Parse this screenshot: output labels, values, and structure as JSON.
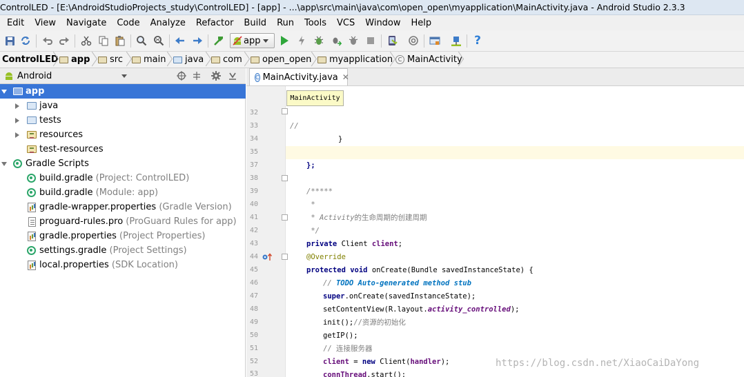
{
  "window": {
    "title": "ControlLED - [E:\\AndroidStudioProjects_study\\ControlLED] - [app] - ...\\app\\src\\main\\java\\com\\open_open\\myapplication\\MainActivity.java - Android Studio 2.3.3"
  },
  "menu": [
    "Edit",
    "View",
    "Navigate",
    "Code",
    "Analyze",
    "Refactor",
    "Build",
    "Run",
    "Tools",
    "VCS",
    "Window",
    "Help"
  ],
  "toolbar": {
    "run_config": "app",
    "icons": [
      "save-all-icon",
      "sync-icon",
      "undo-icon",
      "redo-icon",
      "cut-icon",
      "copy-icon",
      "paste-icon",
      "find-icon",
      "replace-icon",
      "back-icon",
      "forward-icon",
      "make-project-icon",
      "run-icon",
      "apply-changes-icon",
      "debug-icon",
      "attach-debugger-icon",
      "stop-icon",
      "avd-manager-icon",
      "sdk-manager-icon",
      "android-monitor-icon",
      "project-structure-icon",
      "help-icon"
    ]
  },
  "breadcrumbs": [
    "ControlLED",
    "app",
    "src",
    "main",
    "java",
    "com",
    "open_open",
    "myapplication",
    "MainActivity"
  ],
  "project_panel": {
    "view_selector": "Android",
    "tree": [
      {
        "label": "app",
        "hint": ""
      },
      {
        "label": "java",
        "hint": ""
      },
      {
        "label": "tests",
        "hint": ""
      },
      {
        "label": "resources",
        "hint": ""
      },
      {
        "label": "test-resources",
        "hint": ""
      },
      {
        "label": "Gradle Scripts",
        "hint": ""
      },
      {
        "label": "build.gradle",
        "hint": "(Project: ControlLED)"
      },
      {
        "label": "build.gradle",
        "hint": "(Module: app)"
      },
      {
        "label": "gradle-wrapper.properties",
        "hint": "(Gradle Version)"
      },
      {
        "label": "proguard-rules.pro",
        "hint": "(ProGuard Rules for app)"
      },
      {
        "label": "gradle.properties",
        "hint": "(Project Properties)"
      },
      {
        "label": "settings.gradle",
        "hint": "(Project Settings)"
      },
      {
        "label": "local.properties",
        "hint": "(SDK Location)"
      }
    ]
  },
  "editor": {
    "tab": "MainActivity.java",
    "tooltip": "MainActivity",
    "line_numbers": [
      "32",
      "33",
      "34",
      "35",
      "37",
      "38",
      "39",
      "40",
      "41",
      "42",
      "43",
      "44",
      "45",
      "46",
      "47",
      "48",
      "49",
      "50",
      "51",
      "52",
      "53"
    ],
    "code": {
      "l32": "//",
      "l33": "}",
      "l35": "};",
      "l38": "/*****",
      "l39": " *",
      "l40_a": " * ",
      "l40_b": "Activity",
      "l40_c": "的生命周期的创建周期",
      "l41": " */",
      "l42_kw": "private",
      "l42_type": " Client ",
      "l42_fld": "client",
      "l42_end": ";",
      "l43": "@Override",
      "l44_kw": "protected void",
      "l44_rest": " onCreate(Bundle savedInstanceState) {",
      "l45_a": "// ",
      "l45_b": "TODO Auto-generated method stub",
      "l46_kw": "super",
      "l46_rest": ".onCreate(savedInstanceState);",
      "l47_a": "setContentView(R.layout.",
      "l47_b": "activity_controlled",
      "l47_c": ");",
      "l48_a": "init();",
      "l48_b": "//资源的初始化",
      "l49": "getIP();",
      "l50": "// 连接服务器",
      "l51_fld": "client",
      "l51_mid": " = ",
      "l51_kw": "new",
      "l51_rest": " Client(",
      "l51_fld2": "handler",
      "l51_end": ");",
      "l52_fld": "connThread",
      "l52_rest": ".start();",
      "l53": "}"
    }
  },
  "watermark": "https://blog.csdn.net/XiaoCaiDaYong",
  "colors": {
    "selection": "#3875d7",
    "keyword": "#000080",
    "comment": "#808080",
    "todo": "#0073bf",
    "field": "#660e7a",
    "annotation": "#808000",
    "run_green": "#2fa73b"
  }
}
